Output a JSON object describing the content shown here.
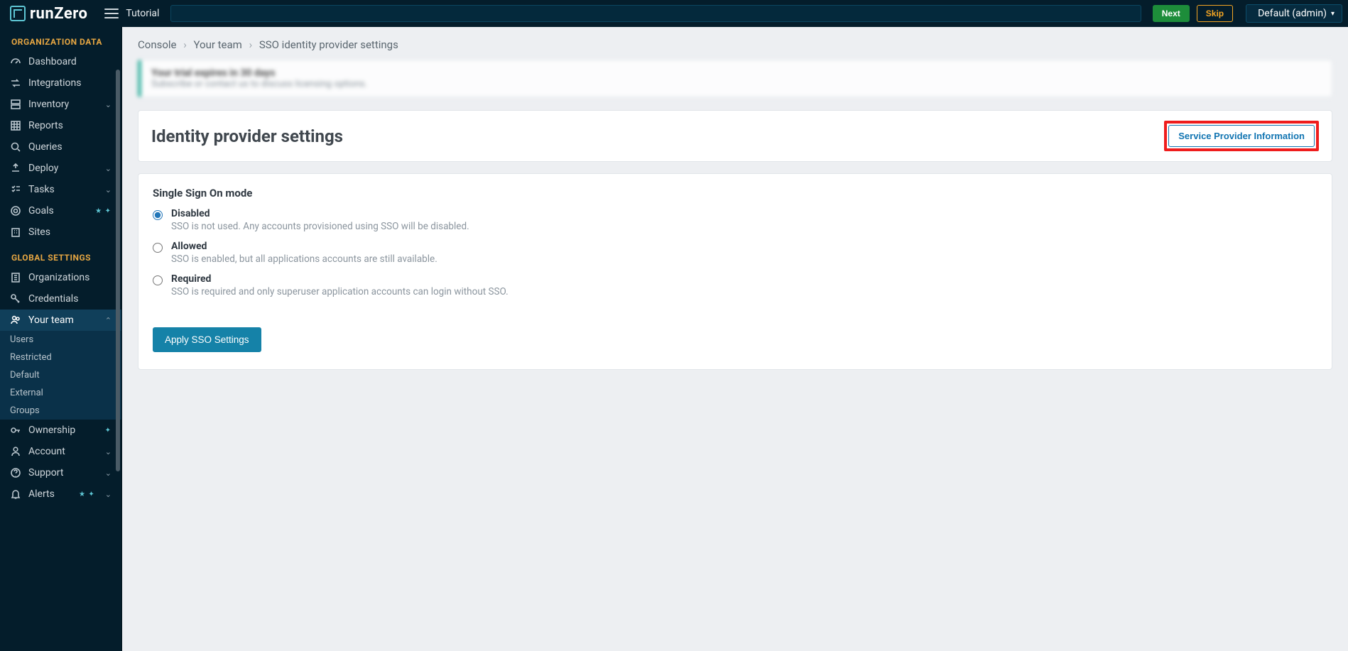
{
  "topbar": {
    "brand": "runZero",
    "tutorial_label": "Tutorial",
    "next_label": "Next",
    "skip_label": "Skip",
    "org_switch": "Default (admin)"
  },
  "sidebar": {
    "section_org": "ORGANIZATION DATA",
    "section_global": "GLOBAL SETTINGS",
    "org_items": [
      {
        "label": "Dashboard"
      },
      {
        "label": "Integrations"
      },
      {
        "label": "Inventory",
        "chevron": true
      },
      {
        "label": "Reports"
      },
      {
        "label": "Queries"
      },
      {
        "label": "Deploy",
        "chevron": true
      },
      {
        "label": "Tasks",
        "chevron": true
      },
      {
        "label": "Goals",
        "stars": true
      },
      {
        "label": "Sites"
      }
    ],
    "global_items": [
      {
        "label": "Organizations"
      },
      {
        "label": "Credentials"
      },
      {
        "label": "Your team",
        "active": true,
        "chevron_up": true
      },
      {
        "label": "Ownership",
        "star_solo": true
      },
      {
        "label": "Account",
        "chevron": true
      },
      {
        "label": "Support",
        "chevron": true
      },
      {
        "label": "Alerts",
        "stars": true,
        "chevron": true
      }
    ],
    "your_team_sub": [
      "Users",
      "Restricted",
      "Default",
      "External",
      "Groups"
    ]
  },
  "breadcrumb": {
    "console": "Console",
    "team": "Your team",
    "current": "SSO identity provider settings"
  },
  "banner": {
    "title": "Your trial expires in 30 days",
    "subtitle": "Subscribe or contact us to discuss licensing options."
  },
  "panel": {
    "title": "Identity provider settings",
    "sp_button": "Service Provider Information"
  },
  "sso": {
    "group_title": "Single Sign On mode",
    "options": [
      {
        "label": "Disabled",
        "desc": "SSO is not used. Any accounts provisioned using SSO will be disabled.",
        "checked": true
      },
      {
        "label": "Allowed",
        "desc": "SSO is enabled, but all applications accounts are still available."
      },
      {
        "label": "Required",
        "desc": "SSO is required and only superuser application accounts can login without SSO."
      }
    ],
    "apply_label": "Apply SSO Settings"
  }
}
